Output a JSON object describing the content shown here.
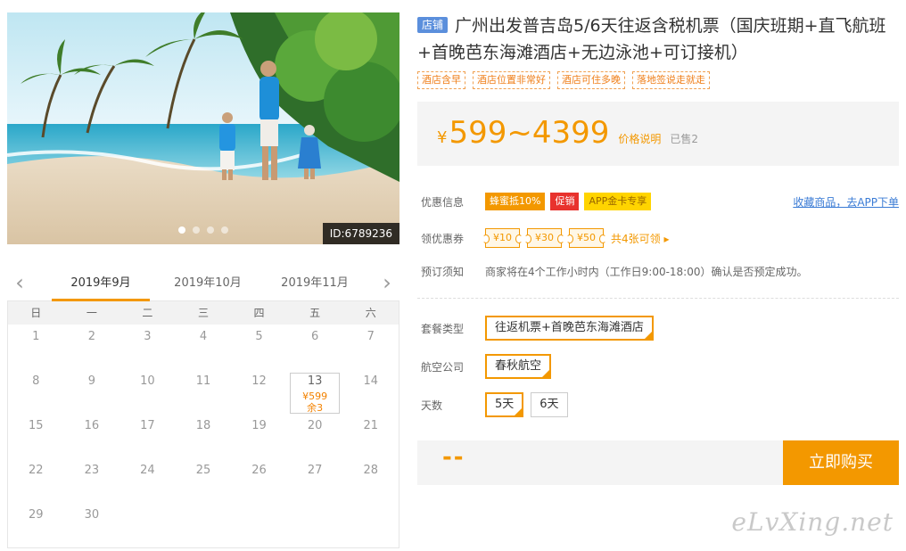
{
  "hero": {
    "id_label": "ID:6789236",
    "slide_count": 4,
    "active_slide": 1
  },
  "calendar": {
    "months": [
      "2019年9月",
      "2019年10月",
      "2019年11月"
    ],
    "active_month": 0,
    "weekdays": [
      "日",
      "一",
      "二",
      "三",
      "四",
      "五",
      "六"
    ],
    "days": [
      {
        "day": "1"
      },
      {
        "day": "2"
      },
      {
        "day": "3"
      },
      {
        "day": "4"
      },
      {
        "day": "5"
      },
      {
        "day": "6"
      },
      {
        "day": "7"
      },
      {
        "day": "8"
      },
      {
        "day": "9"
      },
      {
        "day": "10"
      },
      {
        "day": "11"
      },
      {
        "day": "12"
      },
      {
        "day": "13",
        "price": "¥599",
        "stock": "余3"
      },
      {
        "day": "14"
      },
      {
        "day": "15"
      },
      {
        "day": "16"
      },
      {
        "day": "17"
      },
      {
        "day": "18"
      },
      {
        "day": "19"
      },
      {
        "day": "20"
      },
      {
        "day": "21"
      },
      {
        "day": "22"
      },
      {
        "day": "23"
      },
      {
        "day": "24"
      },
      {
        "day": "25"
      },
      {
        "day": "26"
      },
      {
        "day": "27"
      },
      {
        "day": "28"
      },
      {
        "day": "29"
      },
      {
        "day": "30"
      }
    ]
  },
  "product": {
    "shop_badge": "店铺",
    "title": "广州出发普吉岛5/6天往返含税机票（国庆班期+直飞航班+首晚芭东海滩酒店+无边泳池+可订接机）",
    "tags": [
      "酒店含早",
      "酒店位置非常好",
      "酒店可住多晚",
      "落地签说走就走"
    ]
  },
  "price": {
    "yen": "¥",
    "range": "599~4399",
    "explain": "价格说明",
    "sold": "已售2"
  },
  "promotions": {
    "label": "优惠信息",
    "items": [
      {
        "text": "蜂蜜抵10%",
        "color": "#f39800"
      },
      {
        "text": "促销",
        "color": "#e8322d"
      },
      {
        "text": "APP金卡专享",
        "color": "#ffd400"
      }
    ],
    "collect_link": "收藏商品，去APP下单"
  },
  "coupons": {
    "label": "领优惠券",
    "items": [
      "¥10",
      "¥30",
      "¥50"
    ],
    "more": "共4张可领 ▸"
  },
  "booking_notice": {
    "label": "预订须知",
    "text": "商家将在4个工作小时内（工作日9:00-18:00）确认是否预定成功。"
  },
  "options": {
    "package": {
      "label": "套餐类型",
      "values": [
        "往返机票+首晚芭东海滩酒店"
      ],
      "selected": 0
    },
    "airline": {
      "label": "航空公司",
      "values": [
        "春秋航空"
      ],
      "selected": 0
    },
    "days": {
      "label": "天数",
      "values": [
        "5天",
        "6天"
      ],
      "selected": 0
    }
  },
  "buy": {
    "total": "--",
    "button": "立即购买"
  },
  "watermark": "eLvXing.net",
  "colors": {
    "accent": "#f39800",
    "link": "#3a7bd5",
    "badge": "#5b8fdc"
  }
}
